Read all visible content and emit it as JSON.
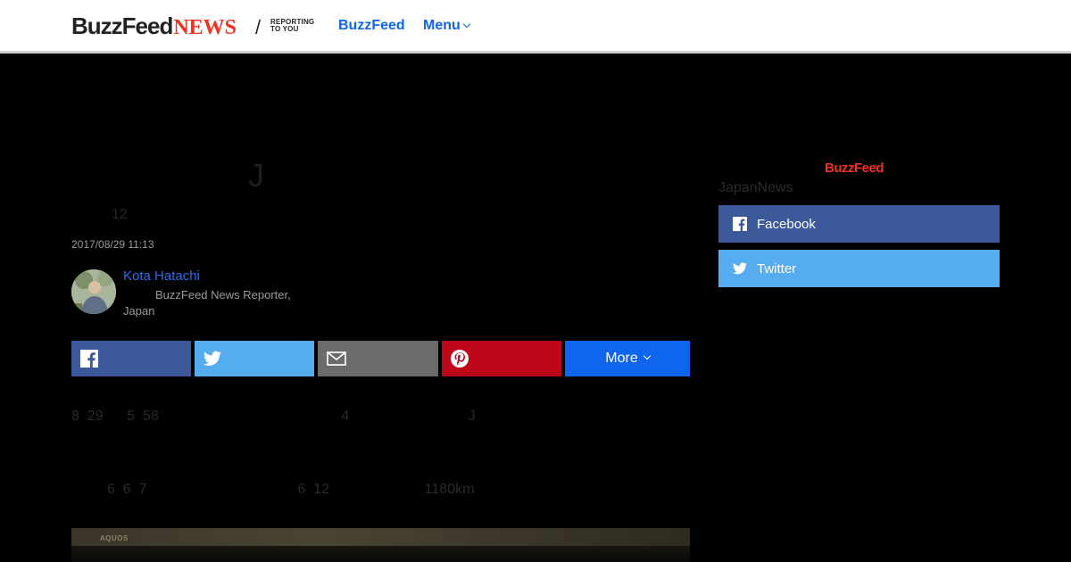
{
  "header": {
    "logo_buzz": "BuzzFeed",
    "logo_news": "NEWS",
    "slash": "/",
    "tagline_line1": "REPORTING",
    "tagline_line2": "TO YOU",
    "nav_buzzfeed": "BuzzFeed",
    "nav_menu": "Menu"
  },
  "article": {
    "headline_visible": "J",
    "subtitle_visible": "12",
    "timestamp": "2017/08/29 11:13",
    "author": {
      "name": "Kota Hatachi",
      "role_line1": "BuzzFeed News Reporter,",
      "role_line2": "Japan"
    },
    "share": {
      "more_label": "More"
    },
    "body_line1": "8  29      5  58                                              4                              J",
    "body_line2": "         6  6  7                                      6  12                        1180km",
    "photo_label": "AQUOS"
  },
  "sidebar": {
    "logo": "BuzzFeed",
    "subtitle": "JapanNews",
    "facebook_label": "Facebook",
    "twitter_label": "Twitter"
  },
  "colors": {
    "facebook": "#3b5998",
    "twitter": "#55acee",
    "email": "#6b6b6b",
    "pinterest": "#bd081c",
    "more": "#0f65ef",
    "brand_red": "#ee3322",
    "link_blue": "#0f65ef"
  }
}
